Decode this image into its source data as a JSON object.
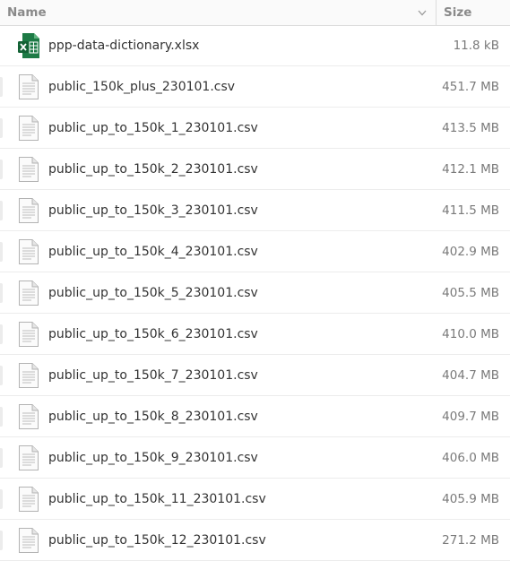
{
  "columns": {
    "name_label": "Name",
    "size_label": "Size"
  },
  "files": [
    {
      "name": "ppp-data-dictionary.xlsx",
      "size": "11.8 kB",
      "icon": "spreadsheet-icon"
    },
    {
      "name": "public_150k_plus_230101.csv",
      "size": "451.7 MB",
      "icon": "text-file-icon"
    },
    {
      "name": "public_up_to_150k_1_230101.csv",
      "size": "413.5 MB",
      "icon": "text-file-icon"
    },
    {
      "name": "public_up_to_150k_2_230101.csv",
      "size": "412.1 MB",
      "icon": "text-file-icon"
    },
    {
      "name": "public_up_to_150k_3_230101.csv",
      "size": "411.5 MB",
      "icon": "text-file-icon"
    },
    {
      "name": "public_up_to_150k_4_230101.csv",
      "size": "402.9 MB",
      "icon": "text-file-icon"
    },
    {
      "name": "public_up_to_150k_5_230101.csv",
      "size": "405.5 MB",
      "icon": "text-file-icon"
    },
    {
      "name": "public_up_to_150k_6_230101.csv",
      "size": "410.0 MB",
      "icon": "text-file-icon"
    },
    {
      "name": "public_up_to_150k_7_230101.csv",
      "size": "404.7 MB",
      "icon": "text-file-icon"
    },
    {
      "name": "public_up_to_150k_8_230101.csv",
      "size": "409.7 MB",
      "icon": "text-file-icon"
    },
    {
      "name": "public_up_to_150k_9_230101.csv",
      "size": "406.0 MB",
      "icon": "text-file-icon"
    },
    {
      "name": "public_up_to_150k_11_230101.csv",
      "size": "405.9 MB",
      "icon": "text-file-icon"
    },
    {
      "name": "public_up_to_150k_12_230101.csv",
      "size": "271.2 MB",
      "icon": "text-file-icon"
    }
  ],
  "colors": {
    "spreadsheet_green": "#1d7a45",
    "header_text": "#8a8a8a",
    "row_border": "#ececec"
  }
}
